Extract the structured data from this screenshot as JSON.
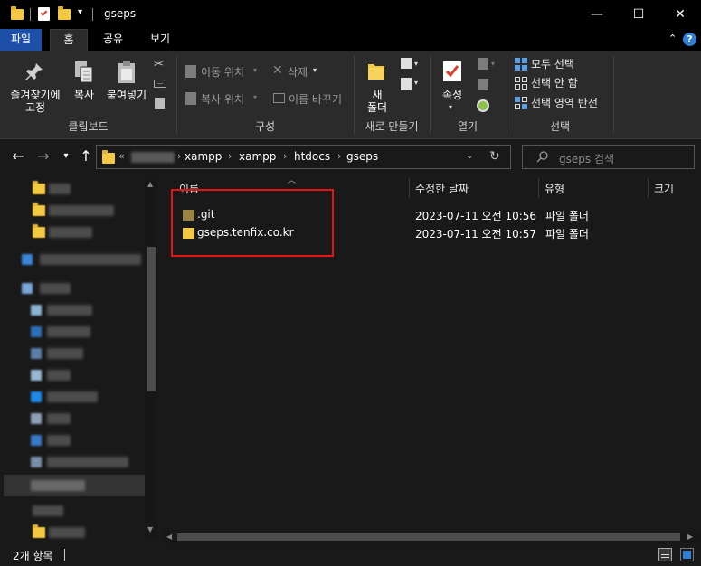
{
  "window": {
    "title": "gseps",
    "minimize": "—",
    "maximize": "☐",
    "close": "✕"
  },
  "ribbon_tabs": {
    "file": "파일",
    "home": "홈",
    "share": "공유",
    "view": "보기"
  },
  "ribbon": {
    "clipboard": {
      "pin": "즐겨찾기에\n고정",
      "copy": "복사",
      "paste": "붙여넣기",
      "label": "클립보드"
    },
    "organize": {
      "move_to": "이동 위치",
      "copy_to": "복사 위치",
      "delete": "삭제",
      "rename": "이름 바꾸기",
      "label": "구성"
    },
    "new": {
      "new_folder": "새\n폴더",
      "label": "새로 만들기"
    },
    "open": {
      "properties": "속성",
      "label": "열기"
    },
    "select": {
      "select_all": "모두 선택",
      "select_none": "선택 안 함",
      "invert": "선택 영역 반전",
      "label": "선택"
    }
  },
  "address": {
    "prefix": "«",
    "crumbs": [
      "xampp",
      "xampp",
      "htdocs",
      "gseps"
    ],
    "search_placeholder": "gseps 검색"
  },
  "columns": {
    "name": "이름",
    "modified": "수정한 날짜",
    "type": "유형",
    "size": "크기"
  },
  "files": [
    {
      "name": ".git",
      "modified": "2023-07-11 오전 10:56",
      "type": "파일 폴더",
      "hidden": true
    },
    {
      "name": "gseps.tenfix.co.kr",
      "modified": "2023-07-11 오전 10:57",
      "type": "파일 폴더",
      "hidden": false
    }
  ],
  "status": {
    "count": "2개 항목"
  },
  "colors": {
    "file_tab": "#1e4fa8",
    "highlight": "#e81313",
    "folder": "#f3c843"
  }
}
